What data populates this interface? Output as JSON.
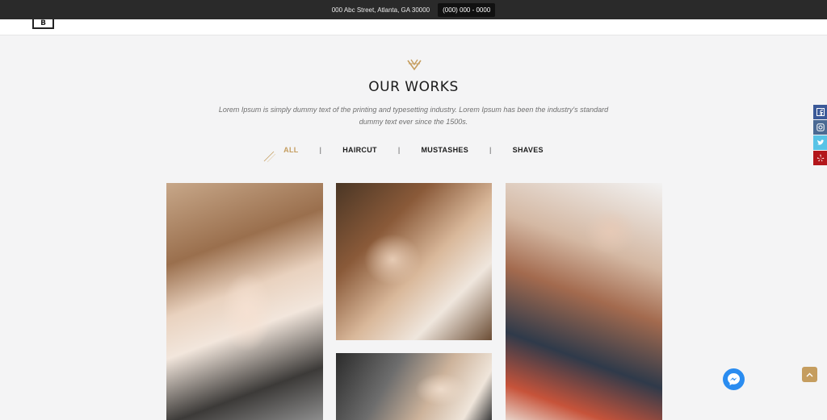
{
  "topbar": {
    "address": "000 Abc Street, Atlanta, GA 30000",
    "phone": "(000) 000 - 0000"
  },
  "brand": {
    "logo_letter": "B"
  },
  "section": {
    "title": "OUR WORKS",
    "description": "Lorem Ipsum is simply dummy text of the printing and typesetting industry. Lorem Ipsum has been the industry's standard dummy text ever since the 1500s."
  },
  "filters": {
    "items": [
      "ALL",
      "HAIRCUT",
      "MUSTASHES",
      "SHAVES"
    ],
    "separator": "|",
    "active_index": 0
  },
  "gallery": {
    "items": [
      {
        "icon": "photo-woman-hairstyling"
      },
      {
        "icon": "photo-beard-trim"
      },
      {
        "icon": "photo-shave"
      },
      {
        "icon": "photo-woman-haircut"
      }
    ]
  },
  "social": [
    "facebook-icon",
    "instagram-icon",
    "twitter-icon",
    "yelp-icon"
  ],
  "colors": {
    "accent": "#c59d5f",
    "topbar": "#2a2a2a",
    "background": "#f4f4f5",
    "messenger": "#2a8cf0"
  }
}
